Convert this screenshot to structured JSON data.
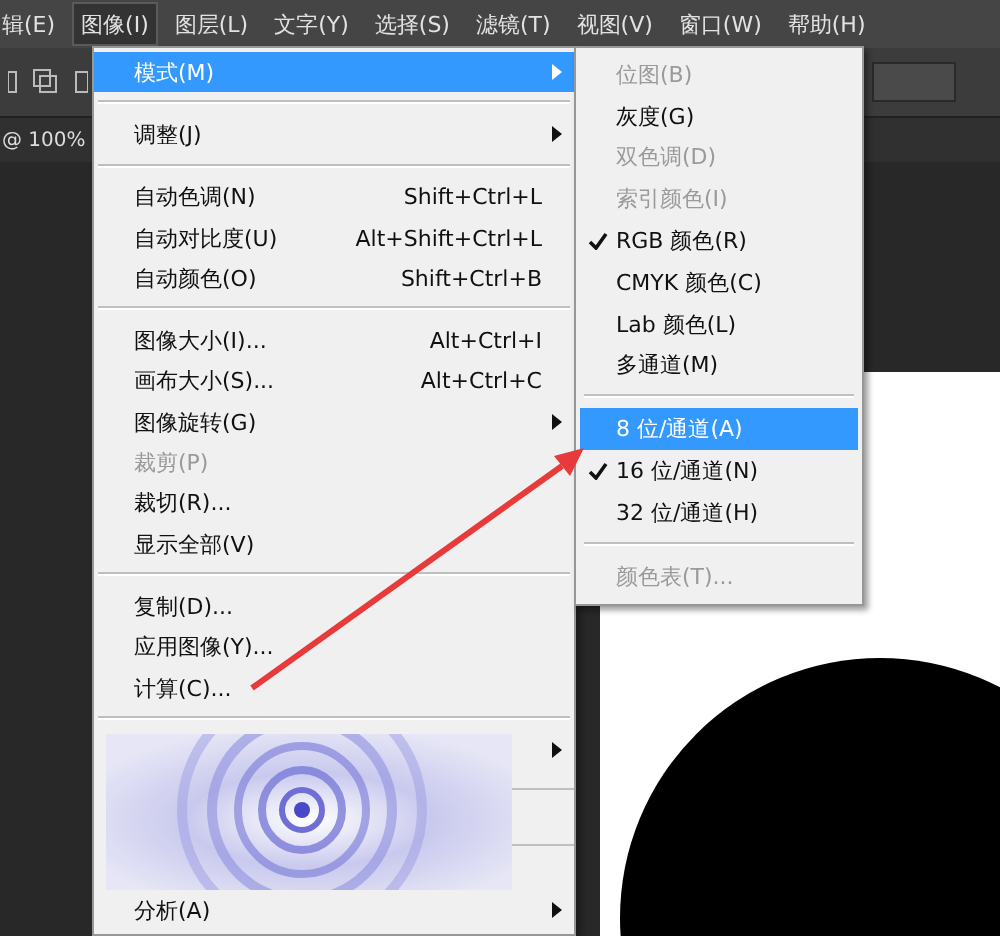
{
  "menubar": [
    {
      "label": "辑(E)",
      "selected": false
    },
    {
      "label": "图像(I)",
      "selected": true
    },
    {
      "label": "图层(L)",
      "selected": false
    },
    {
      "label": "文字(Y)",
      "selected": false
    },
    {
      "label": "选择(S)",
      "selected": false
    },
    {
      "label": "滤镜(T)",
      "selected": false
    },
    {
      "label": "视图(V)",
      "selected": false
    },
    {
      "label": "窗口(W)",
      "selected": false
    },
    {
      "label": "帮助(H)",
      "selected": false
    }
  ],
  "document_tab": {
    "label": "@ 100%"
  },
  "image_menu": [
    {
      "kind": "item",
      "label": "模式(M)",
      "has_submenu": true,
      "selected": true,
      "disabled": false
    },
    {
      "kind": "separator"
    },
    {
      "kind": "item",
      "label": "调整(J)",
      "has_submenu": true,
      "selected": false,
      "disabled": false
    },
    {
      "kind": "separator"
    },
    {
      "kind": "item",
      "label": "自动色调(N)",
      "shortcut": "Shift+Ctrl+L",
      "selected": false,
      "disabled": false
    },
    {
      "kind": "item",
      "label": "自动对比度(U)",
      "shortcut": "Alt+Shift+Ctrl+L",
      "selected": false,
      "disabled": false
    },
    {
      "kind": "item",
      "label": "自动颜色(O)",
      "shortcut": "Shift+Ctrl+B",
      "selected": false,
      "disabled": false
    },
    {
      "kind": "separator"
    },
    {
      "kind": "item",
      "label": "图像大小(I)...",
      "shortcut": "Alt+Ctrl+I",
      "selected": false,
      "disabled": false
    },
    {
      "kind": "item",
      "label": "画布大小(S)...",
      "shortcut": "Alt+Ctrl+C",
      "selected": false,
      "disabled": false
    },
    {
      "kind": "item",
      "label": "图像旋转(G)",
      "has_submenu": true,
      "selected": false,
      "disabled": false
    },
    {
      "kind": "item",
      "label": "裁剪(P)",
      "selected": false,
      "disabled": true
    },
    {
      "kind": "item",
      "label": "裁切(R)...",
      "selected": false,
      "disabled": false
    },
    {
      "kind": "item",
      "label": "显示全部(V)",
      "selected": false,
      "disabled": false
    },
    {
      "kind": "separator"
    },
    {
      "kind": "item",
      "label": "复制(D)...",
      "selected": false,
      "disabled": false
    },
    {
      "kind": "item",
      "label": "应用图像(Y)...",
      "selected": false,
      "disabled": false
    },
    {
      "kind": "item",
      "label": "计算(C)...",
      "selected": false,
      "disabled": false
    },
    {
      "kind": "separator"
    },
    {
      "kind": "picture",
      "has_submenu": true
    },
    {
      "kind": "item",
      "label": "分析(A)",
      "has_submenu": true,
      "selected": false
    }
  ],
  "mode_submenu": [
    {
      "kind": "item",
      "label": "位图(B)",
      "disabled": true,
      "checked": false,
      "selected": false
    },
    {
      "kind": "item",
      "label": "灰度(G)",
      "disabled": false,
      "checked": false,
      "selected": false
    },
    {
      "kind": "item",
      "label": "双色调(D)",
      "disabled": true,
      "checked": false,
      "selected": false
    },
    {
      "kind": "item",
      "label": "索引颜色(I)",
      "disabled": true,
      "checked": false,
      "selected": false
    },
    {
      "kind": "item",
      "label": "RGB 颜色(R)",
      "disabled": false,
      "checked": true,
      "selected": false
    },
    {
      "kind": "item",
      "label": "CMYK 颜色(C)",
      "disabled": false,
      "checked": false,
      "selected": false
    },
    {
      "kind": "item",
      "label": "Lab 颜色(L)",
      "disabled": false,
      "checked": false,
      "selected": false
    },
    {
      "kind": "item",
      "label": "多通道(M)",
      "disabled": false,
      "checked": false,
      "selected": false
    },
    {
      "kind": "separator"
    },
    {
      "kind": "item",
      "label": "8 位/通道(A)",
      "disabled": false,
      "checked": false,
      "selected": true
    },
    {
      "kind": "item",
      "label": "16 位/通道(N)",
      "disabled": false,
      "checked": true,
      "selected": false
    },
    {
      "kind": "item",
      "label": "32 位/通道(H)",
      "disabled": false,
      "checked": false,
      "selected": false
    },
    {
      "kind": "separator"
    },
    {
      "kind": "item",
      "label": "颜色表(T)...",
      "disabled": true,
      "checked": false,
      "selected": false
    }
  ]
}
